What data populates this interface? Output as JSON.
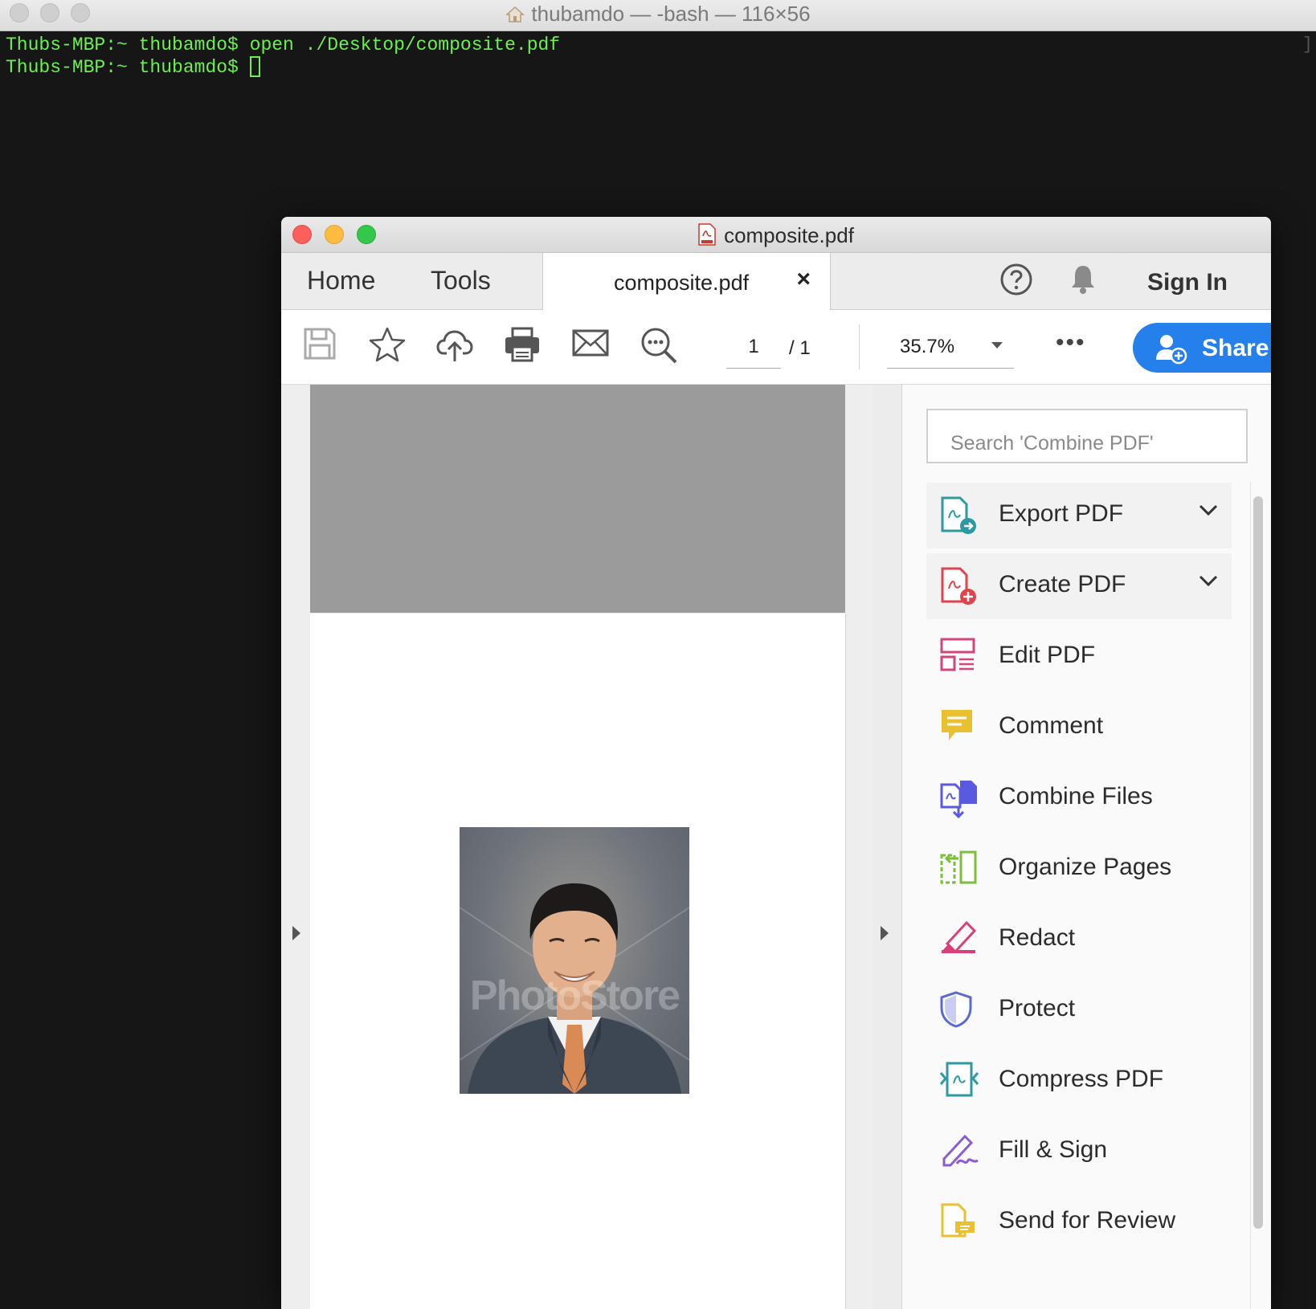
{
  "terminal": {
    "title": "thubamdo — -bash — 116×56",
    "lines": [
      "Thubs-MBP:~ thubamdo$ open ./Desktop/composite.pdf",
      "Thubs-MBP:~ thubamdo$ "
    ],
    "bracket": "]"
  },
  "acrobat": {
    "window_title": "composite.pdf",
    "tabs": {
      "home": "Home",
      "tools": "Tools",
      "document": "composite.pdf",
      "close": "×"
    },
    "sign_in": "Sign In",
    "toolbar": {
      "page_current": "1",
      "page_total": "/  1",
      "zoom": "35.7%",
      "more": "•••",
      "share": "Share"
    },
    "document": {
      "watermark": "PhotoStore"
    },
    "tools_panel": {
      "search_placeholder": "Search 'Combine PDF'",
      "items": [
        {
          "label": "Export PDF",
          "icon": "export-pdf-icon",
          "color": "#2d9aa3",
          "expandable": true
        },
        {
          "label": "Create PDF",
          "icon": "create-pdf-icon",
          "color": "#e0444b",
          "expandable": true
        },
        {
          "label": "Edit PDF",
          "icon": "edit-pdf-icon",
          "color": "#d0457e",
          "expandable": false
        },
        {
          "label": "Comment",
          "icon": "comment-icon",
          "color": "#e8c030",
          "expandable": false
        },
        {
          "label": "Combine Files",
          "icon": "combine-files-icon",
          "color": "#5a5ae0",
          "expandable": false
        },
        {
          "label": "Organize Pages",
          "icon": "organize-pages-icon",
          "color": "#7cbf3a",
          "expandable": false
        },
        {
          "label": "Redact",
          "icon": "redact-icon",
          "color": "#d8407a",
          "expandable": false
        },
        {
          "label": "Protect",
          "icon": "protect-icon",
          "color": "#5b6ad0",
          "expandable": false
        },
        {
          "label": "Compress PDF",
          "icon": "compress-pdf-icon",
          "color": "#2d9aa3",
          "expandable": false
        },
        {
          "label": "Fill & Sign",
          "icon": "fill-sign-icon",
          "color": "#8a5cd0",
          "expandable": false
        },
        {
          "label": "Send for Review",
          "icon": "send-for-review-icon",
          "color": "#e8c030",
          "expandable": false
        }
      ]
    },
    "colors": {
      "share_button": "#2680eb",
      "terminal_text": "#6cf04e"
    }
  }
}
